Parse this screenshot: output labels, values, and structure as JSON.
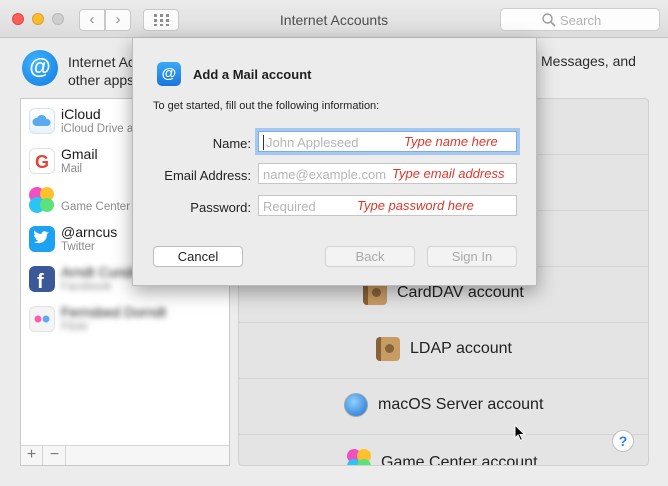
{
  "window": {
    "title": "Internet Accounts",
    "search_placeholder": "Search",
    "nav_back": "‹",
    "nav_forward": "›"
  },
  "header": {
    "line1": "Internet Ac",
    "line2": "other apps",
    "right_text": "Messages, and"
  },
  "sidebar": {
    "accounts": [
      {
        "name": "iCloud",
        "subtitle": "iCloud Drive a",
        "icon": "icloud-icon"
      },
      {
        "name": "Gmail",
        "subtitle": "Mail",
        "icon": "gmail-icon"
      },
      {
        "name": "",
        "subtitle": "Game Center",
        "icon": "game-center-icon"
      },
      {
        "name": "@arncus",
        "subtitle": "Twitter",
        "icon": "twitter-icon"
      },
      {
        "name": "Arndt Cunder",
        "subtitle": "Facebook",
        "icon": "facebook-icon"
      },
      {
        "name": "Fernsbed Dorndt",
        "subtitle": "Flickr",
        "icon": "flickr-icon"
      }
    ],
    "add_label": "+",
    "remove_label": "−"
  },
  "providers": [
    {
      "label": "CardDAV account",
      "icon": "carddav-icon"
    },
    {
      "label": "LDAP account",
      "icon": "ldap-icon"
    },
    {
      "label": "macOS Server account",
      "icon": "macos-server-icon"
    },
    {
      "label": "Game Center account",
      "icon": "game-center-icon"
    }
  ],
  "help_label": "?",
  "sheet": {
    "title": "Add a Mail account",
    "intro": "To get started, fill out the following information:",
    "fields": [
      {
        "label": "Name:",
        "placeholder": "John Appleseed",
        "note": "Type name here"
      },
      {
        "label": "Email Address:",
        "placeholder": "name@example.com",
        "note": "Type email address"
      },
      {
        "label": "Password:",
        "placeholder": "Required",
        "note": "Type password here"
      }
    ],
    "buttons": {
      "cancel": "Cancel",
      "back": "Back",
      "sign_in": "Sign In"
    }
  },
  "colors": {
    "accent": "#1a75db",
    "annotation": "#e0362c"
  }
}
